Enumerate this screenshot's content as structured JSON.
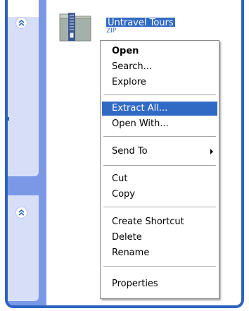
{
  "file": {
    "name": "Untravel Tours",
    "name_line2": "ZIP"
  },
  "context_menu": {
    "items": [
      {
        "label": "Open",
        "bold": true
      },
      {
        "label": "Search..."
      },
      {
        "label": "Explore"
      },
      {
        "label": "Extract All...",
        "highlighted": true
      },
      {
        "label": "Open With..."
      },
      {
        "label": "Send To",
        "submenu": true
      },
      {
        "label": "Cut"
      },
      {
        "label": "Copy"
      },
      {
        "label": "Create Shortcut"
      },
      {
        "label": "Delete"
      },
      {
        "label": "Rename"
      },
      {
        "label": "Properties"
      }
    ]
  },
  "taskpane": {
    "icons": [
      "collapse-chevron-up-icon",
      "collapse-chevron-up-icon"
    ]
  },
  "colors": {
    "frame_blue": "#2a62c2",
    "highlight": "#316ac5",
    "taskpane": "#7b98e6"
  }
}
